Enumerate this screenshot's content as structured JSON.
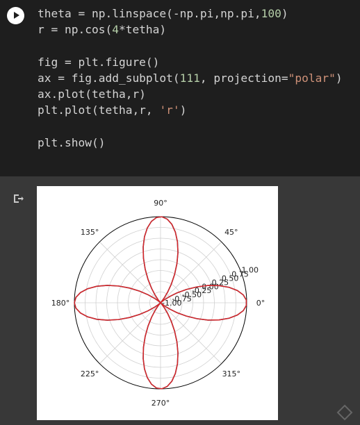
{
  "code_cell": {
    "lines": [
      [
        {
          "t": "theta = np.linspace(-np.pi,np.pi,"
        },
        {
          "t": "100",
          "c": "num"
        },
        {
          "t": ")"
        }
      ],
      [
        {
          "t": "r = np.cos("
        },
        {
          "t": "4",
          "c": "num"
        },
        {
          "t": "*tetha)"
        }
      ],
      [],
      [
        {
          "t": "fig = plt.figure()"
        }
      ],
      [
        {
          "t": "ax = fig.add_subplot("
        },
        {
          "t": "111",
          "c": "num"
        },
        {
          "t": ", projection="
        },
        {
          "t": "\"polar\"",
          "c": "str"
        },
        {
          "t": ")"
        }
      ],
      [
        {
          "t": "ax.plot(tetha,r)"
        }
      ],
      [
        {
          "t": "plt.plot(tetha,r, "
        },
        {
          "t": "'r'",
          "c": "str"
        },
        {
          "t": ")"
        }
      ],
      [],
      [
        {
          "t": "plt.show()"
        }
      ]
    ]
  },
  "chart_data": {
    "type": "polar_line",
    "function": "r = cos(4*theta)",
    "theta_range": [
      -3.14159,
      3.14159
    ],
    "num_points": 100,
    "series": [
      {
        "color": "#1f77b4",
        "note": "overdrawn"
      },
      {
        "color": "#d62728"
      }
    ],
    "angle_labels": [
      "0°",
      "45°",
      "90°",
      "135°",
      "180°",
      "225°",
      "270°",
      "315°"
    ],
    "radial_ticks": [
      "-1.00",
      "-0.75",
      "-0.50",
      "-0.25",
      "0.00",
      "0.25",
      "0.50",
      "0.75",
      "1.00"
    ],
    "r_range": [
      -1.0,
      1.0
    ],
    "grid": true
  }
}
